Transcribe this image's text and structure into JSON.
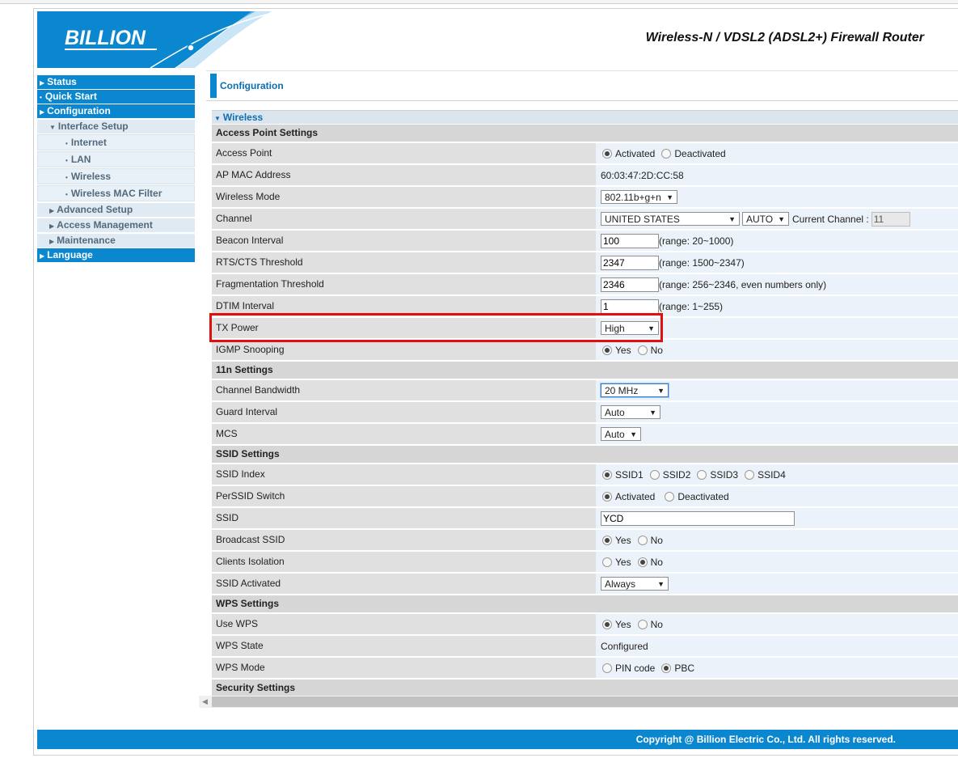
{
  "brand": {
    "logo": "BILLION",
    "title": "Wireless-N / VDSL2 (ADSL2+) Firewall Router",
    "accent": "#0b87cf"
  },
  "sidebar": {
    "items": [
      {
        "label": "Status"
      },
      {
        "label": "Quick Start"
      },
      {
        "label": "Configuration"
      },
      {
        "label": "Interface Setup"
      },
      {
        "label": "Internet"
      },
      {
        "label": "LAN"
      },
      {
        "label": "Wireless"
      },
      {
        "label": "Wireless MAC Filter"
      },
      {
        "label": "Advanced Setup"
      },
      {
        "label": "Access Management"
      },
      {
        "label": "Maintenance"
      },
      {
        "label": "Language"
      }
    ]
  },
  "page": {
    "title": "Configuration",
    "section": "Wireless"
  },
  "groups": {
    "ap": "Access Point Settings",
    "n11": "11n Settings",
    "ssid": "SSID Settings",
    "wps": "WPS Settings",
    "security": "Security Settings"
  },
  "fields": {
    "access_point": {
      "label": "Access Point",
      "opt1": "Activated",
      "opt2": "Deactivated"
    },
    "ap_mac": {
      "label": "AP MAC Address",
      "value": "60:03:47:2D:CC:58"
    },
    "wireless_mode": {
      "label": "Wireless Mode",
      "value": "802.11b+g+n"
    },
    "channel": {
      "label": "Channel",
      "country": "UNITED STATES",
      "mode": "AUTO",
      "current_label": "Current Channel :",
      "current": "11"
    },
    "beacon": {
      "label": "Beacon Interval",
      "value": "100",
      "range": "(range: 20~1000)"
    },
    "rts": {
      "label": "RTS/CTS Threshold",
      "value": "2347",
      "range": "(range: 1500~2347)"
    },
    "frag": {
      "label": "Fragmentation Threshold",
      "value": "2346",
      "range": "(range: 256~2346, even numbers only)"
    },
    "dtim": {
      "label": "DTIM Interval",
      "value": "1",
      "range": "(range: 1~255)"
    },
    "tx_power": {
      "label": "TX Power",
      "value": "High"
    },
    "igmp": {
      "label": "IGMP Snooping",
      "opt1": "Yes",
      "opt2": "No"
    },
    "bandwidth": {
      "label": "Channel Bandwidth",
      "value": "20 MHz"
    },
    "guard": {
      "label": "Guard Interval",
      "value": "Auto"
    },
    "mcs": {
      "label": "MCS",
      "value": "Auto"
    },
    "ssid_index": {
      "label": "SSID Index",
      "o1": "SSID1",
      "o2": "SSID2",
      "o3": "SSID3",
      "o4": "SSID4"
    },
    "perssid": {
      "label": "PerSSID Switch",
      "opt1": "Activated",
      "opt2": "Deactivated"
    },
    "ssid": {
      "label": "SSID",
      "value": "YCD"
    },
    "broadcast": {
      "label": "Broadcast SSID",
      "opt1": "Yes",
      "opt2": "No"
    },
    "isolation": {
      "label": "Clients Isolation",
      "opt1": "Yes",
      "opt2": "No"
    },
    "ssid_activated": {
      "label": "SSID Activated",
      "value": "Always"
    },
    "use_wps": {
      "label": "Use WPS",
      "opt1": "Yes",
      "opt2": "No"
    },
    "wps_state": {
      "label": "WPS State",
      "value": "Configured"
    },
    "wps_mode": {
      "label": "WPS Mode",
      "opt1": "PIN code",
      "opt2": "PBC"
    }
  },
  "footer": {
    "copyright": "Copyright @ Billion Electric Co., Ltd. All rights reserved."
  }
}
